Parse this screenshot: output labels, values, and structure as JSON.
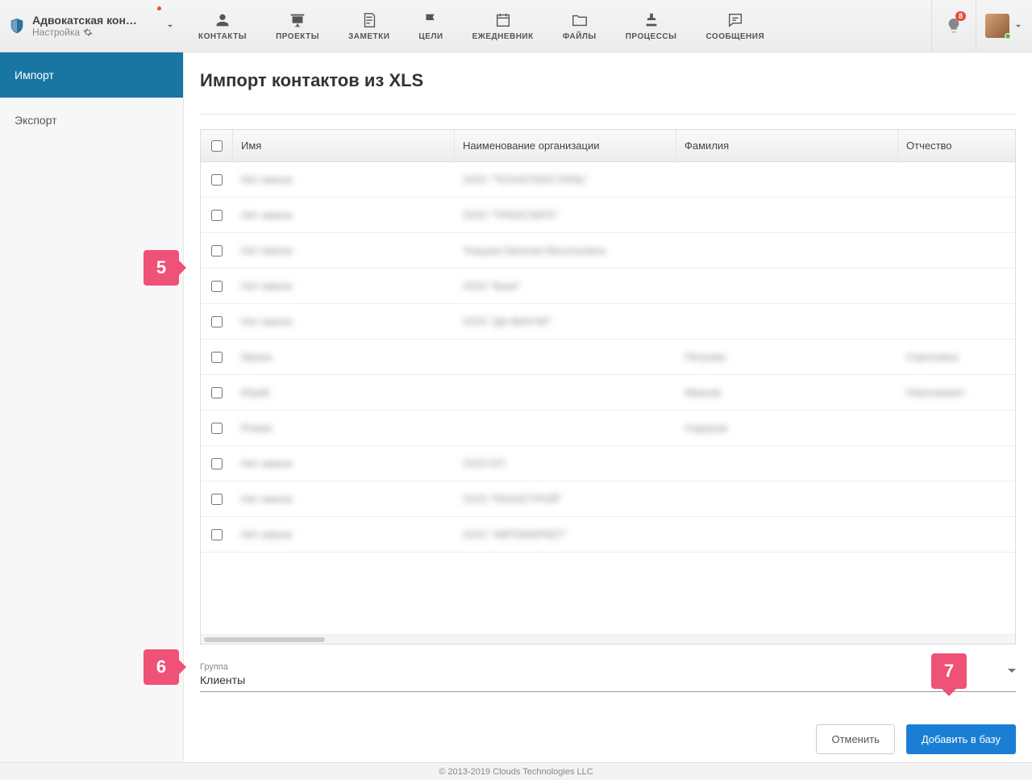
{
  "workspace": {
    "name": "Адвокатская кон…",
    "subtitle": "Настройка"
  },
  "nav": [
    {
      "label": "КОНТАКТЫ"
    },
    {
      "label": "ПРОЕКТЫ"
    },
    {
      "label": "ЗАМЕТКИ"
    },
    {
      "label": "ЦЕЛИ"
    },
    {
      "label": "ЕЖЕДНЕВНИК"
    },
    {
      "label": "ФАЙЛЫ"
    },
    {
      "label": "ПРОЦЕССЫ"
    },
    {
      "label": "СООБЩЕНИЯ"
    }
  ],
  "notifications": {
    "count": "8"
  },
  "sidebar": {
    "items": [
      {
        "label": "Импорт",
        "active": true
      },
      {
        "label": "Экспорт",
        "active": false
      }
    ]
  },
  "page": {
    "title": "Импорт контактов из XLS"
  },
  "table": {
    "headers": {
      "name": "Имя",
      "org": "Наименование организации",
      "lastname": "Фамилия",
      "patronymic": "Отчество"
    },
    "rows": [
      {
        "name": "Нет имени",
        "org": "ООО \"ТЕХНОТЕКСТИЛЬ\"",
        "lastname": "",
        "patronymic": ""
      },
      {
        "name": "Нет имени",
        "org": "ООО \"ТРАНСЛИГА\"",
        "lastname": "",
        "patronymic": ""
      },
      {
        "name": "Нет имени",
        "org": "Ткацкая Евгения Васильевна",
        "lastname": "",
        "patronymic": ""
      },
      {
        "name": "Нет имени",
        "org": "ООО \"Банк\"",
        "lastname": "",
        "patronymic": ""
      },
      {
        "name": "Нет имени",
        "org": "ООО \"ДА-ВИНЧИ\"",
        "lastname": "",
        "patronymic": ""
      },
      {
        "name": "Ирина",
        "org": "",
        "lastname": "Петрова",
        "patronymic": "Сергеевна"
      },
      {
        "name": "Юрий",
        "org": "",
        "lastname": "Иванов",
        "patronymic": "Николаевич"
      },
      {
        "name": "Роман",
        "org": "",
        "lastname": "Сидоров",
        "patronymic": ""
      },
      {
        "name": "Нет имени",
        "org": "ООО ЕП",
        "lastname": "",
        "patronymic": ""
      },
      {
        "name": "Нет имени",
        "org": "ООО \"РЕАЛСТРОЙ\"",
        "lastname": "",
        "patronymic": ""
      },
      {
        "name": "Нет имени",
        "org": "ООО \"АВТОМАРКЕТ\"",
        "lastname": "",
        "patronymic": ""
      }
    ]
  },
  "group": {
    "label": "Группа",
    "value": "Клиенты"
  },
  "buttons": {
    "cancel": "Отменить",
    "submit": "Добавить в базу"
  },
  "callouts": {
    "c5": "5",
    "c6": "6",
    "c7": "7"
  },
  "footer": "© 2013-2019 Clouds Technologies LLC"
}
